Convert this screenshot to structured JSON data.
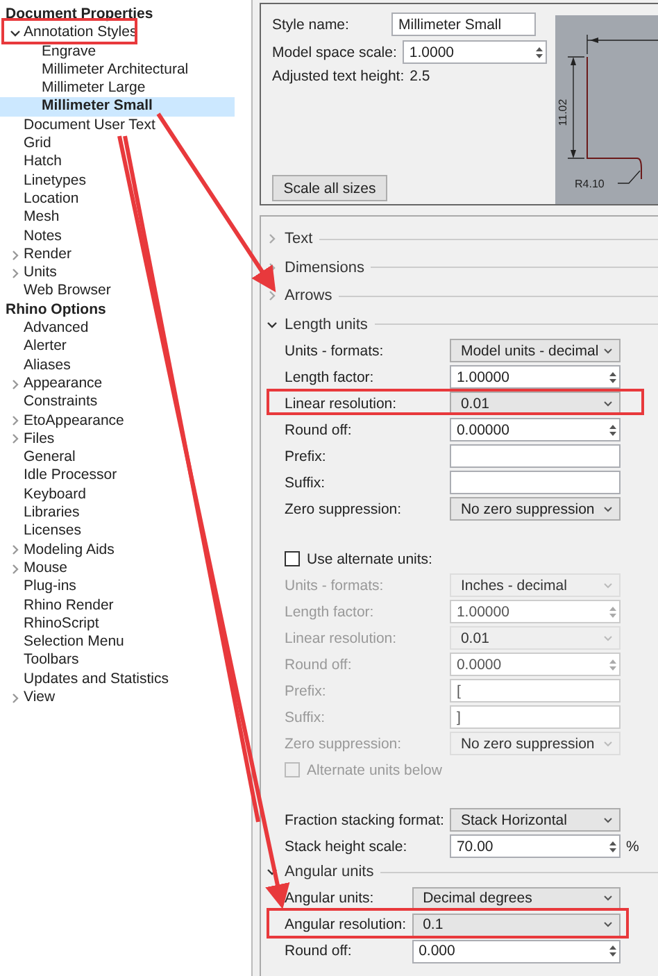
{
  "tree": [
    {
      "label": "Document Properties",
      "kind": "heading",
      "selected": false,
      "children": [
        {
          "label": "Annotation Styles",
          "selected": false,
          "expanded": true,
          "children": [
            {
              "label": "Engrave",
              "selected": false
            },
            {
              "label": "Millimeter Architectural",
              "selected": false
            },
            {
              "label": "Millimeter Large",
              "selected": false
            },
            {
              "label": "Millimeter Small",
              "selected": true
            }
          ]
        },
        {
          "label": "Document User Text",
          "selected": false
        },
        {
          "label": "Grid",
          "selected": false
        },
        {
          "label": "Hatch",
          "selected": false
        },
        {
          "label": "Linetypes",
          "selected": false
        },
        {
          "label": "Location",
          "selected": false
        },
        {
          "label": "Mesh",
          "selected": false
        },
        {
          "label": "Notes",
          "selected": false
        },
        {
          "label": "Render",
          "selected": false,
          "expanded": false
        },
        {
          "label": "Units",
          "selected": false,
          "expanded": false
        },
        {
          "label": "Web Browser",
          "selected": false
        }
      ]
    },
    {
      "label": "Rhino Options",
      "kind": "heading",
      "selected": false,
      "children": [
        {
          "label": "Advanced",
          "selected": false
        },
        {
          "label": "Alerter",
          "selected": false
        },
        {
          "label": "Aliases",
          "selected": false
        },
        {
          "label": "Appearance",
          "selected": false,
          "expanded": false
        },
        {
          "label": "Constraints",
          "selected": false
        },
        {
          "label": "EtoAppearance",
          "selected": false,
          "expanded": false
        },
        {
          "label": "Files",
          "selected": false,
          "expanded": false
        },
        {
          "label": "General",
          "selected": false
        },
        {
          "label": "Idle Processor",
          "selected": false
        },
        {
          "label": "Keyboard",
          "selected": false
        },
        {
          "label": "Libraries",
          "selected": false
        },
        {
          "label": "Licenses",
          "selected": false
        },
        {
          "label": "Modeling Aids",
          "selected": false,
          "expanded": false
        },
        {
          "label": "Mouse",
          "selected": false,
          "expanded": false
        },
        {
          "label": "Plug-ins",
          "selected": false
        },
        {
          "label": "Rhino Render",
          "selected": false
        },
        {
          "label": "RhinoScript",
          "selected": false
        },
        {
          "label": "Selection Menu",
          "selected": false
        },
        {
          "label": "Toolbars",
          "selected": false
        },
        {
          "label": "Updates and Statistics",
          "selected": false
        },
        {
          "label": "View",
          "selected": false,
          "expanded": false
        }
      ]
    }
  ],
  "style": {
    "name_label": "Style name:",
    "name_value": "Millimeter Small",
    "scale_label": "Model space scale:",
    "scale_value": "1.0000",
    "height_label": "Adjusted text height:",
    "height_value": "2.5",
    "scale_button": "Scale all sizes",
    "preview_labels": [
      "11.02",
      "R4.10"
    ]
  },
  "sections": [
    {
      "title": "Text",
      "expanded": false
    },
    {
      "title": "Dimensions",
      "expanded": false
    },
    {
      "title": "Arrows",
      "expanded": false
    },
    {
      "title": "Length units",
      "expanded": true,
      "rows": [
        {
          "kind": "dropdown",
          "label": "Units - formats:",
          "value": "Model units - decimal",
          "disabled": false
        },
        {
          "kind": "spin",
          "label": "Length factor:",
          "value": "1.00000",
          "disabled": false
        },
        {
          "kind": "dropdown",
          "label": "Linear resolution:",
          "value": "0.01",
          "disabled": false
        },
        {
          "kind": "spin",
          "label": "Round off:",
          "value": "0.00000",
          "disabled": false
        },
        {
          "kind": "text",
          "label": "Prefix:",
          "disabled": false
        },
        {
          "kind": "text",
          "label": "Suffix:",
          "disabled": false
        },
        {
          "kind": "dropdown",
          "label": "Zero suppression:",
          "value": "No zero suppression",
          "disabled": false
        },
        {
          "kind": "gap"
        },
        {
          "kind": "check",
          "label": "Use alternate units:",
          "checked": false,
          "disabled": false
        },
        {
          "kind": "dropdown",
          "label": "Units - formats:",
          "value": "Inches - decimal",
          "disabled": true
        },
        {
          "kind": "spin",
          "label": "Length factor:",
          "value": "1.00000",
          "disabled": true
        },
        {
          "kind": "dropdown",
          "label": "Linear resolution:",
          "value": "0.01",
          "disabled": true
        },
        {
          "kind": "spin",
          "label": "Round off:",
          "value": "0.0000",
          "disabled": true
        },
        {
          "kind": "text",
          "label": "Prefix:",
          "value": "[",
          "disabled": true
        },
        {
          "kind": "text",
          "label": "Suffix:",
          "value": "]",
          "disabled": true
        },
        {
          "kind": "dropdown",
          "label": "Zero suppression:",
          "value": "No zero suppression",
          "disabled": true
        },
        {
          "kind": "check",
          "label": "Alternate units below",
          "checked": false,
          "disabled": true
        },
        {
          "kind": "gap"
        },
        {
          "kind": "dropdown",
          "label": "Fraction stacking format:",
          "value": "Stack Horizontal",
          "disabled": false
        },
        {
          "kind": "spin",
          "label": "Stack height scale:",
          "value": "70.00",
          "suffix": "%",
          "disabled": false
        }
      ]
    },
    {
      "title": "Angular units",
      "expanded": true,
      "rows": [
        {
          "kind": "dropdown",
          "label": "Angular units:",
          "value": "Decimal degrees",
          "disabled": false
        },
        {
          "kind": "dropdown",
          "label": "Angular resolution:",
          "value": "0.1",
          "disabled": false
        },
        {
          "kind": "spin",
          "label": "Round off:",
          "value": "0.000",
          "disabled": false
        }
      ]
    }
  ]
}
